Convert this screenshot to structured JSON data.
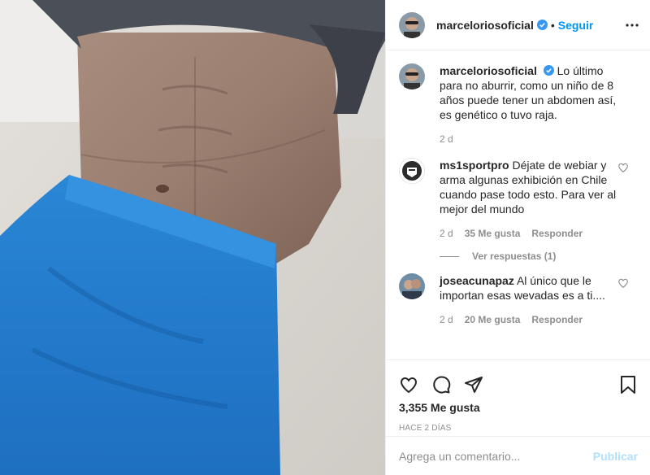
{
  "post": {
    "username": "marceloriosoficial",
    "dot": "•",
    "follow_label": "Seguir",
    "image_alt": "Foto de abdomen",
    "caption_user": "marceloriosoficial",
    "caption_text": "Lo último para no aburrir, como un niño de 8 años puede tener un abdomen así, es genético o tuvo raja.",
    "caption_time": "2 d"
  },
  "comments": [
    {
      "user": "ms1sportpro",
      "text": "Déjate de webiar y arma algunas exhibición en Chile cuando pase todo esto. Para ver al mejor del mundo",
      "time": "2 d",
      "likes": "35 Me gusta",
      "reply": "Responder",
      "view_replies": "Ver respuestas (1)"
    },
    {
      "user": "joseacunapaz",
      "text": "Al único que le importan esas wevadas es a ti....",
      "time": "2 d",
      "likes": "20 Me gusta",
      "reply": "Responder"
    }
  ],
  "actions": {
    "likes": "3,355 Me gusta",
    "ago": "HACE 2 DÍAS"
  },
  "composer": {
    "placeholder": "Agrega un comentario...",
    "post_label": "Publicar"
  },
  "colors": {
    "accent": "#0095f6",
    "verified": "#3897f0",
    "muted": "#8e8e8e"
  }
}
